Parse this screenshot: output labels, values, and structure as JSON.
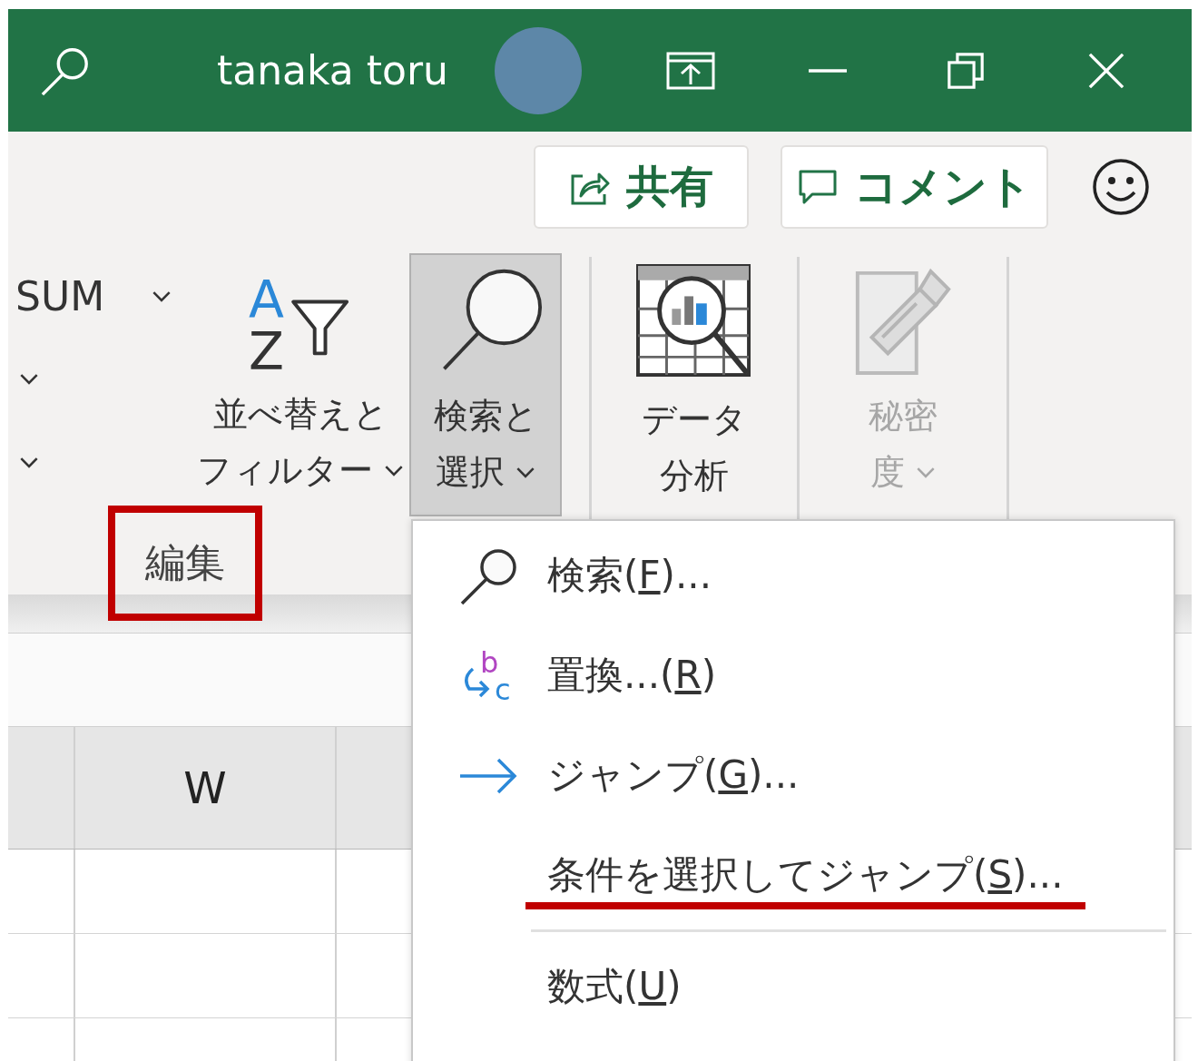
{
  "title_bar": {
    "user_name": "tanaka toru"
  },
  "share_button": {
    "label": "共有"
  },
  "comment_button": {
    "label": "コメント"
  },
  "ribbon": {
    "left_partial": {
      "function": "SUM"
    },
    "commands": [
      {
        "kind": "sort_filter",
        "icon_letters": [
          "A",
          "Z"
        ],
        "lines": [
          "並べ替えと",
          "フィルター"
        ],
        "dropdown": true,
        "selected": false,
        "disabled": false
      },
      {
        "kind": "find_select",
        "lines": [
          "検索と",
          "選択"
        ],
        "dropdown": true,
        "selected": true,
        "disabled": false
      },
      {
        "kind": "data_analysis",
        "lines": [
          "データ",
          "分析"
        ],
        "dropdown": false,
        "selected": false,
        "disabled": false
      },
      {
        "kind": "sensitivity",
        "lines": [
          "秘密",
          "度"
        ],
        "dropdown": true,
        "selected": false,
        "disabled": true
      }
    ],
    "group_label": {
      "text": "編集",
      "highlighted": true
    }
  },
  "sheet": {
    "column_header": "W"
  },
  "menu": {
    "items": [
      {
        "kind": "search",
        "before": "検索(",
        "key": "F",
        "after": ")...",
        "highlighted": false
      },
      {
        "kind": "replace",
        "icon_letters": [
          "b",
          "c"
        ],
        "before": "置換...(",
        "key": "R",
        "after": ")",
        "highlighted": false
      },
      {
        "kind": "arrow",
        "before": "ジャンプ(",
        "key": "G",
        "after": ")...",
        "highlighted": false
      },
      {
        "kind": "none",
        "before": "条件を選択してジャンプ(",
        "key": "S",
        "after": ")...",
        "highlighted": true
      },
      {
        "kind": "separator"
      },
      {
        "kind": "none",
        "before": "数式(",
        "key": "U",
        "after": ")",
        "highlighted": false
      }
    ]
  }
}
